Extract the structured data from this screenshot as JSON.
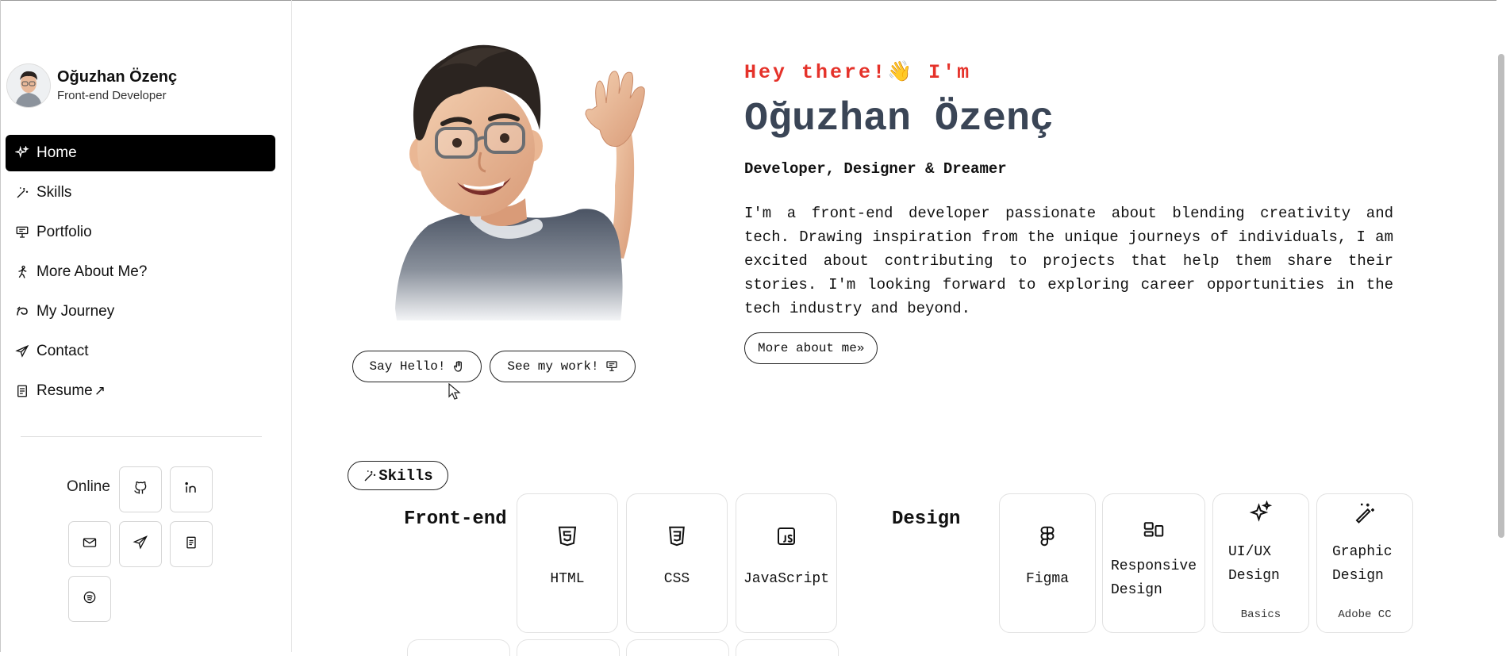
{
  "sidebar": {
    "profile": {
      "name": "Oğuzhan Özenç",
      "role": "Front-end Developer"
    },
    "nav": [
      {
        "label": "Home",
        "icon": "sparkles-icon",
        "active": true
      },
      {
        "label": "Skills",
        "icon": "magic-wand-icon"
      },
      {
        "label": "Portfolio",
        "icon": "presentation-icon"
      },
      {
        "label": "More About Me?",
        "icon": "running-icon"
      },
      {
        "label": "My Journey",
        "icon": "journey-icon"
      },
      {
        "label": "Contact",
        "icon": "send-icon"
      },
      {
        "label": "Resume",
        "icon": "document-icon",
        "external": "↗"
      }
    ],
    "online_label": "Online",
    "social": [
      {
        "name": "github-icon"
      },
      {
        "name": "linkedin-icon"
      },
      {
        "name": "mail-icon"
      },
      {
        "name": "telegram-icon"
      },
      {
        "name": "resume-icon"
      },
      {
        "name": "spotify-icon"
      }
    ]
  },
  "hero": {
    "greeting": "Hey there!👋 I'm",
    "name": "Oğuzhan Özenç",
    "tagline": "Developer, Designer & Dreamer",
    "bio": "I'm a front-end developer passionate about blending creativity and tech. Drawing inspiration from the unique journeys of individuals, I am excited about contributing to projects that help them share their stories. I'm looking forward to exploring career opportunities in the tech industry and beyond.",
    "say_hello": "Say Hello!",
    "see_work": "See my work!",
    "more_about": "More about me»"
  },
  "skills": {
    "badge": "Skills",
    "frontend": {
      "title": "Front-end",
      "items": [
        {
          "label": "HTML",
          "icon": "html5-icon"
        },
        {
          "label": "CSS",
          "icon": "css3-icon"
        },
        {
          "label": "JavaScript",
          "icon": "javascript-icon"
        }
      ]
    },
    "design": {
      "title": "Design",
      "items": [
        {
          "label": "Figma",
          "icon": "figma-icon"
        },
        {
          "label": "Responsive Design",
          "icon": "layout-icon"
        },
        {
          "label": "UI/UX Design",
          "icon": "sparkles-icon",
          "sub": "Basics"
        },
        {
          "label": "Graphic Design",
          "icon": "magic-wand-icon",
          "sub": "Adobe CC"
        }
      ]
    }
  },
  "colors": {
    "accent_red": "#e5322a",
    "name_slate": "#3a4556",
    "active_nav": "#000000"
  }
}
